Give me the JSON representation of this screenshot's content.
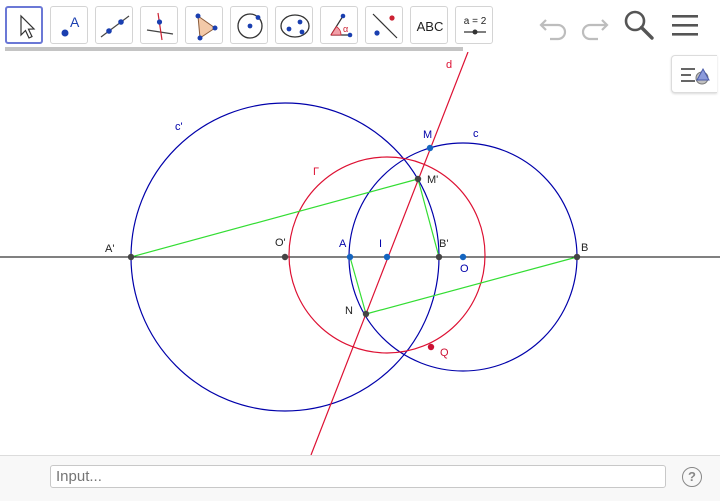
{
  "toolbar": {
    "tools": [
      {
        "name": "move-tool",
        "label": ""
      },
      {
        "name": "point-tool",
        "label": "A"
      },
      {
        "name": "line-tool",
        "label": ""
      },
      {
        "name": "perpendicular-line-tool",
        "label": ""
      },
      {
        "name": "polygon-tool",
        "label": ""
      },
      {
        "name": "circle-center-point-tool",
        "label": ""
      },
      {
        "name": "ellipse-tool",
        "label": ""
      },
      {
        "name": "angle-tool",
        "label": "α"
      },
      {
        "name": "reflect-tool",
        "label": ""
      },
      {
        "name": "text-tool",
        "label": "ABC"
      },
      {
        "name": "slider-tool",
        "label": "a = 2"
      }
    ],
    "selected_tool": "move-tool",
    "undo_icon": "undo-icon",
    "redo_icon": "redo-icon",
    "search_icon": "search-icon",
    "menu_icon": "hamburger-menu-icon"
  },
  "stylebar_toggle_icon": "style-bar-icon",
  "input_bar": {
    "placeholder": "Input...",
    "help_label": "?"
  },
  "construction": {
    "labels": {
      "d": "d",
      "c_prime": "c'",
      "c": "c",
      "M": "M",
      "M_prime": "M'",
      "Gamma": "Γ",
      "A_prime": "A'",
      "O_prime": "O'",
      "A": "A",
      "I": "I",
      "B_prime": "B'",
      "B": "B",
      "O": "O",
      "N": "N",
      "Q": "Q"
    },
    "colors": {
      "blue_objects": "#0000aa",
      "red_objects": "#dd1133",
      "green_segments": "#33dd33",
      "axis": "#000000",
      "free_point": "#1565c0",
      "dependent_point": "#444444",
      "red_point": "#cc1133",
      "tool_selected_border": "#6b78d6"
    }
  }
}
